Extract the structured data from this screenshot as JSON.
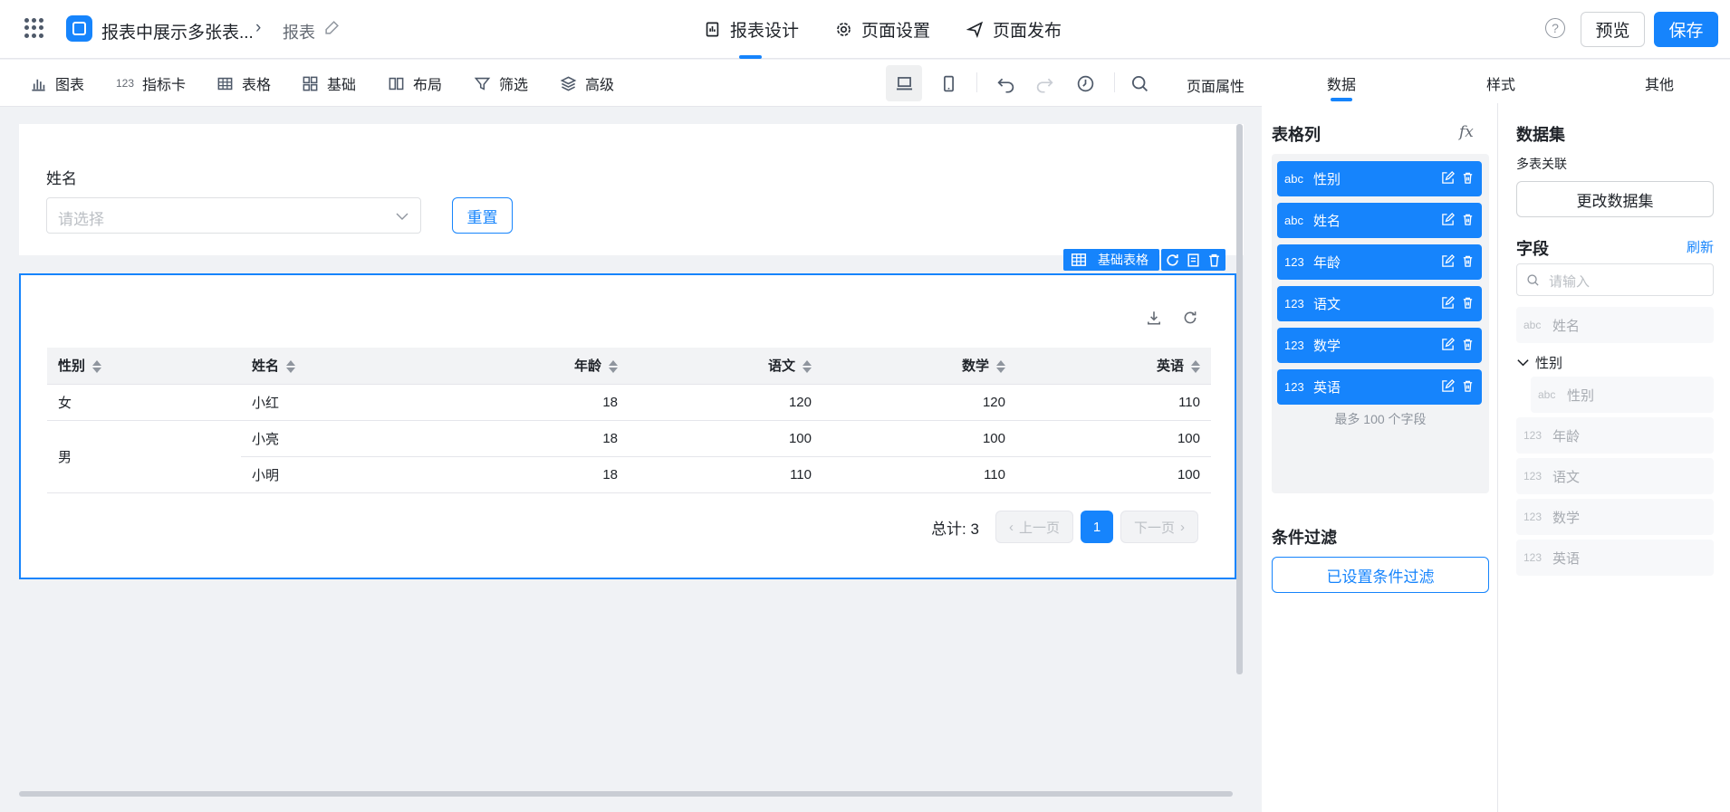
{
  "header": {
    "app_title": "报表中展示多张表...",
    "breadcrumb_sep": "›",
    "breadcrumb_item": "报表",
    "tabs": [
      {
        "label": "报表设计",
        "icon": "report-design-icon"
      },
      {
        "label": "页面设置",
        "icon": "gear-icon"
      },
      {
        "label": "页面发布",
        "icon": "send-icon"
      }
    ],
    "help": "?",
    "preview_label": "预览",
    "save_label": "保存"
  },
  "toolbar": {
    "items": [
      {
        "label": "图表",
        "icon": "bar-chart-icon"
      },
      {
        "label": "指标卡",
        "icon": "metric-card-icon",
        "glyph": "123"
      },
      {
        "label": "表格",
        "icon": "table-icon"
      },
      {
        "label": "基础",
        "icon": "grid-icon"
      },
      {
        "label": "布局",
        "icon": "layout-icon"
      },
      {
        "label": "筛选",
        "icon": "filter-icon"
      },
      {
        "label": "高级",
        "icon": "layers-icon"
      }
    ],
    "page_attr": "页面属性"
  },
  "filter": {
    "label": "姓名",
    "placeholder": "请选择",
    "reset_label": "重置"
  },
  "table_widget": {
    "tag_label": "基础表格",
    "columns": [
      "性别",
      "姓名",
      "年龄",
      "语文",
      "数学",
      "英语"
    ],
    "rows": [
      {
        "gender": "女",
        "name": "小红",
        "age": "18",
        "chinese": "120",
        "math": "120",
        "english": "110"
      },
      {
        "gender": "男",
        "name": "小亮",
        "age": "18",
        "chinese": "100",
        "math": "100",
        "english": "100"
      },
      {
        "gender": "",
        "name": "小明",
        "age": "18",
        "chinese": "110",
        "math": "110",
        "english": "100"
      }
    ],
    "total": "总计: 3",
    "prev": "上一页",
    "next": "下一页",
    "current_page": "1"
  },
  "panel": {
    "tabs": [
      "数据",
      "样式",
      "其他"
    ],
    "columns_title": "表格列",
    "fx": "fx",
    "columns": [
      {
        "type": "abc",
        "name": "性别"
      },
      {
        "type": "abc",
        "name": "姓名"
      },
      {
        "type": "123",
        "name": "年龄"
      },
      {
        "type": "123",
        "name": "语文"
      },
      {
        "type": "123",
        "name": "数学"
      },
      {
        "type": "123",
        "name": "英语"
      }
    ],
    "columns_note": "最多 100 个字段",
    "cond_title": "条件过滤",
    "cond_button": "已设置条件过滤",
    "dataset_title": "数据集",
    "dataset_sub": "多表关联",
    "dataset_button": "更改数据集",
    "fields_title": "字段",
    "refresh": "刷新",
    "field_search_placeholder": "请输入",
    "fields_top": {
      "type": "abc",
      "name": "姓名"
    },
    "field_group": "性别",
    "field_group_child": {
      "type": "abc",
      "name": "性别"
    },
    "fields_rest": [
      {
        "type": "123",
        "name": "年龄"
      },
      {
        "type": "123",
        "name": "语文"
      },
      {
        "type": "123",
        "name": "数学"
      },
      {
        "type": "123",
        "name": "英语"
      }
    ]
  },
  "colors": {
    "accent": "#1684fc",
    "bg": "#f0f2f5"
  }
}
